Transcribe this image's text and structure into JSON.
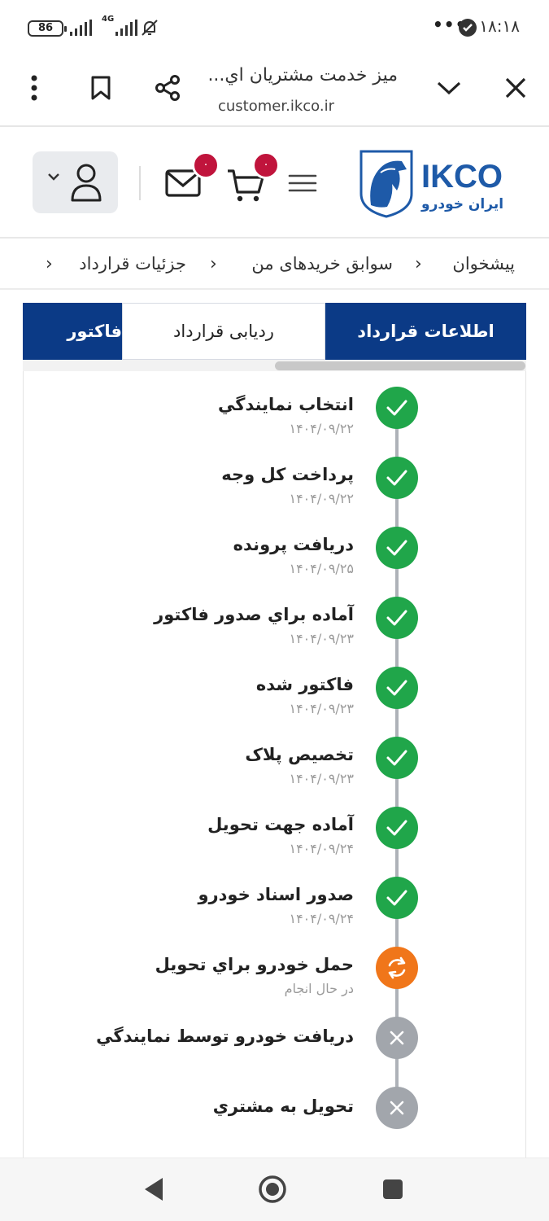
{
  "status_bar": {
    "time": "۱۸:۱۸",
    "battery": "86",
    "network": "4G",
    "dots": "•••"
  },
  "browser": {
    "page_title": "ميز خدمت مشتريان اي...",
    "url": "customer.ikco.ir"
  },
  "header": {
    "logo_text": "IKCO",
    "logo_subtext": "ايران خودرو",
    "cart_count": "۰",
    "messages_count": "۰"
  },
  "breadcrumb": [
    "پيشخوان",
    "سوابق خريدهای من",
    "جزئيات قرارداد"
  ],
  "tabs": [
    {
      "label": "اطلاعات قرارداد",
      "active": true
    },
    {
      "label": "رديابی قرارداد",
      "active": false
    },
    {
      "label": "فاکتور",
      "active": true
    }
  ],
  "timeline": [
    {
      "label": "انتخاب نمايندگي",
      "date": "۱۴۰۴/۰۹/۲۲",
      "status": "done"
    },
    {
      "label": "پرداخت کل وجه",
      "date": "۱۴۰۴/۰۹/۲۲",
      "status": "done"
    },
    {
      "label": "دريافت پرونده",
      "date": "۱۴۰۴/۰۹/۲۵",
      "status": "done"
    },
    {
      "label": "آماده براي صدور فاکتور",
      "date": "۱۴۰۴/۰۹/۲۳",
      "status": "done"
    },
    {
      "label": "فاکتور شده",
      "date": "۱۴۰۴/۰۹/۲۳",
      "status": "done"
    },
    {
      "label": "تخصيص پلاک",
      "date": "۱۴۰۴/۰۹/۲۳",
      "status": "done"
    },
    {
      "label": "آماده جهت تحويل",
      "date": "۱۴۰۴/۰۹/۲۴",
      "status": "done"
    },
    {
      "label": "صدور اسناد خودرو",
      "date": "۱۴۰۴/۰۹/۲۴",
      "status": "done"
    },
    {
      "label": "حمل خودرو براي تحويل",
      "date": "در حال انجام",
      "status": "in-progress"
    },
    {
      "label": "دريافت خودرو توسط نمايندگي",
      "date": "",
      "status": "pending"
    },
    {
      "label": "تحويل به مشتري",
      "date": "",
      "status": "pending"
    }
  ],
  "colors": {
    "brand": "#0b3a86",
    "done": "#20a64a",
    "in_progress": "#f0761a",
    "pending": "#a2a6ac",
    "badge": "#c0143c"
  }
}
